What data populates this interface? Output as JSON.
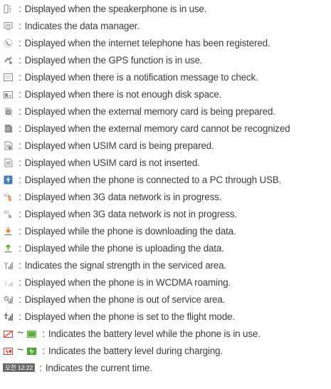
{
  "separator": ":",
  "approx": "~",
  "rows": [
    {
      "icon": "speakerphone-icon",
      "text": "Displayed when the speakerphone is in use."
    },
    {
      "icon": "data-manager-icon",
      "text": "Indicates the data manager."
    },
    {
      "icon": "internet-telephone-icon",
      "text": "Displayed when the internet telephone has been registered."
    },
    {
      "icon": "gps-icon",
      "text": "Displayed when the GPS function is in use."
    },
    {
      "icon": "notification-message-icon",
      "text": "Displayed when there is a notification message to check."
    },
    {
      "icon": "low-disk-space-icon",
      "text": "Displayed when there is not enough disk space."
    },
    {
      "icon": "memory-card-preparing-icon",
      "text": "Displayed when the external memory card is being prepared."
    },
    {
      "icon": "memory-card-unrecognized-icon",
      "text": "Displayed when the external memory card cannot be recognized"
    },
    {
      "icon": "usim-preparing-icon",
      "text": "Displayed when USIM card is being prepared."
    },
    {
      "icon": "usim-not-inserted-icon",
      "text": "Displayed when USIM card is not inserted."
    },
    {
      "icon": "usb-connection-icon",
      "text": "Displayed when the phone is connected to a PC through USB."
    },
    {
      "icon": "3g-data-in-progress-icon",
      "text": "Displayed when 3G data network is in progress."
    },
    {
      "icon": "3g-data-not-in-progress-icon",
      "text": "Displayed when 3G data network is not in progress."
    },
    {
      "icon": "downloading-icon",
      "text": "Displayed while the phone is downloading the data."
    },
    {
      "icon": "uploading-icon",
      "text": "Displayed while the phone is uploading the data."
    },
    {
      "icon": "signal-strength-icon",
      "text": "Indicates the signal strength in the serviced area."
    },
    {
      "icon": "wcdma-roaming-icon",
      "text": "Displayed when the phone is in WCDMA roaming."
    },
    {
      "icon": "out-of-service-icon",
      "text": "Displayed when the phone is out of service area."
    },
    {
      "icon": "flight-mode-icon",
      "text": "Displayed when the phone is set to the flight mode."
    },
    {
      "icon": "battery-level-icon",
      "icon_end": "battery-full-icon",
      "text": "Indicates the battery level while the phone is in use."
    },
    {
      "icon": "battery-charging-icon",
      "icon_end": "battery-charging-full-icon",
      "text": "Indicates the battery level during charging."
    },
    {
      "icon": "current-time-icon",
      "icon_text": "오전 12:22",
      "text": "Indicates the current time."
    }
  ],
  "colors": {
    "text": "#3c3c3c",
    "icon_gray": "#8a8a8a",
    "accent_green": "#5cae3a",
    "accent_orange": "#e87a1e",
    "accent_red": "#d63c2e",
    "usb_blue": "#4a7ab8"
  }
}
